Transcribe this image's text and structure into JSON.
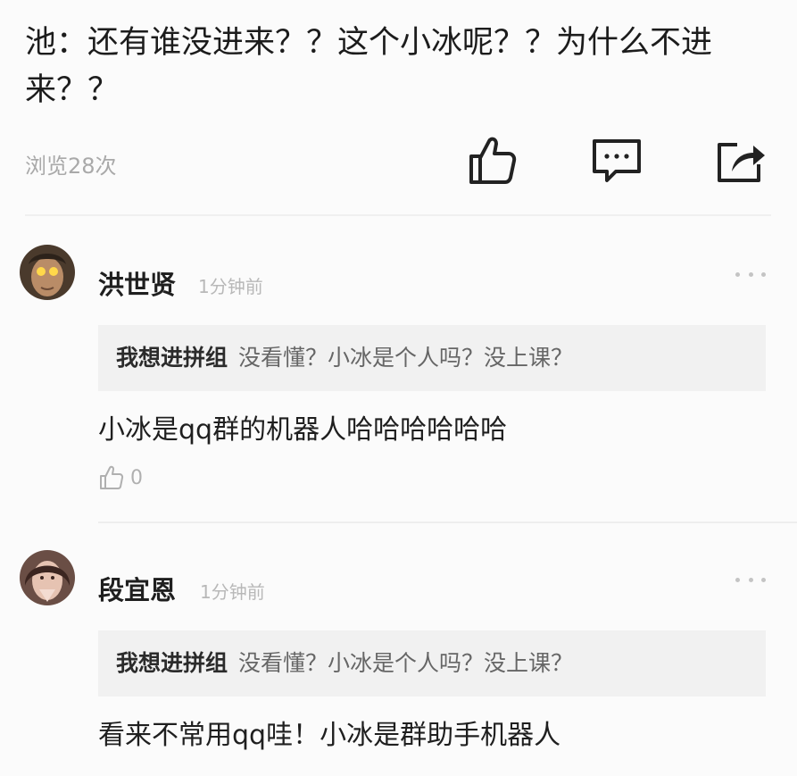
{
  "post": {
    "text": "池：还有谁没进来？？这个小冰呢？？为什么不进来？？",
    "views": "浏览28次"
  },
  "actions": {
    "like_icon": "thumbs-up-icon",
    "comment_icon": "comment-icon",
    "share_icon": "share-icon"
  },
  "comments": [
    {
      "username": "洪世贤",
      "time": "1分钟前",
      "quote_author": "我想进拼组",
      "quote_text": "没看懂？小冰是个人吗？没上课？",
      "reply": "小冰是qq群的机器人哈哈哈哈哈哈",
      "likes": "0"
    },
    {
      "username": "段宜恩",
      "time": "1分钟前",
      "quote_author": "我想进拼组",
      "quote_text": "没看懂？小冰是个人吗？没上课？",
      "reply": "看来不常用qq哇！小冰是群助手机器人"
    }
  ],
  "colors": {
    "background": "#fbfbfb",
    "quote_bg": "#f1f1f1",
    "muted": "#a9a9a9"
  }
}
